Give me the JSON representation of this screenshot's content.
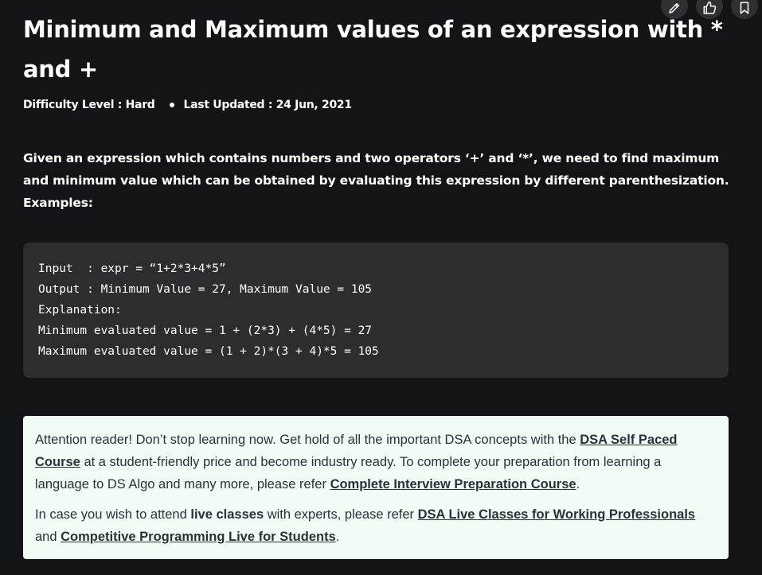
{
  "article": {
    "title": "Minimum and Maximum values of an expression with * and +",
    "difficulty_label": "Difficulty Level : Hard",
    "last_updated_label": "Last Updated : 24 Jun, 2021",
    "intro_text": "Given an expression which contains numbers and two operators ‘+’ and ‘*’, we need to find maximum and minimum value which can be obtained by evaluating this expression by different parenthesization.",
    "examples_label": "Examples:"
  },
  "toolbar": {
    "icons": [
      "pencil-icon",
      "thumbs-up-icon",
      "bookmark-icon"
    ]
  },
  "code_example": {
    "lines": [
      "Input  : expr = “1+2*3+4*5”",
      "Output : Minimum Value = 27, Maximum Value = 105",
      "Explanation:",
      "Minimum evaluated value = 1 + (2*3) + (4*5) = 27",
      "Maximum evaluated value = (1 + 2)*(3 + 4)*5 = 105"
    ]
  },
  "notice": {
    "p1_text1": "Attention reader! Don’t stop learning now. Get hold of all the important DSA concepts with the ",
    "p1_link1": "DSA Self Paced Course",
    "p1_text2": " at a student-friendly price and become industry ready.  To complete your preparation from learning a language to DS Algo and many more,  please refer ",
    "p1_link2": "Complete Interview Preparation Course",
    "p1_text3": ".",
    "p2_text1": "In case you wish to attend ",
    "p2_bold": "live classes",
    "p2_text2": " with experts, please refer ",
    "p2_link1": "DSA Live Classes for Working Professionals",
    "p2_text3": " and ",
    "p2_link2": "Competitive Programming Live for Students",
    "p2_text4": "."
  },
  "colors": {
    "background": "#131417",
    "code_background": "#2c2d30",
    "notice_background": "#f2fcf7",
    "notice_text": "#273239"
  }
}
